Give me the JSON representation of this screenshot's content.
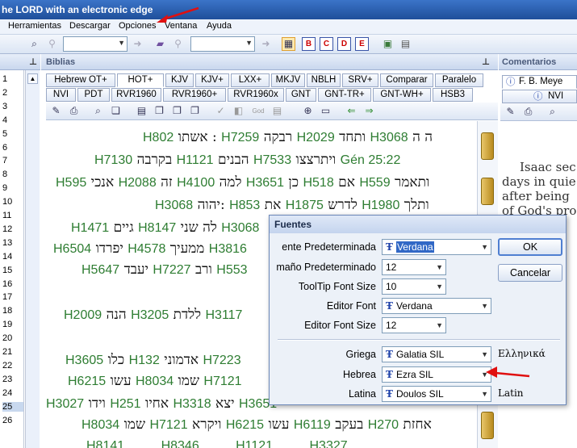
{
  "title": "he LORD with an electronic edge",
  "menu": [
    "Herramientas",
    "Descargar",
    "Opciones",
    "Ventana",
    "Ayuda"
  ],
  "panels": {
    "bibles": "Biblias",
    "comments": "Comentarios"
  },
  "line_numbers": [
    "1",
    "2",
    "3",
    "4",
    "5",
    "6",
    "7",
    "8",
    "9",
    "10",
    "11",
    "12",
    "13",
    "14",
    "15",
    "16",
    "17",
    "18",
    "19",
    "20",
    "21",
    "22",
    "23",
    "24",
    "25",
    "26"
  ],
  "selected_line": "25",
  "bible_tabs_row1": [
    "Hebrew OT+",
    "HOT+",
    "KJV",
    "KJV+",
    "LXX+",
    "MKJV",
    "NBLH",
    "SRV+",
    "Comparar",
    "Paralelo"
  ],
  "bible_tabs_row2": [
    "NVI",
    "PDT",
    "RVR1960",
    "RVR1960+",
    "RVR1960x",
    "GNT",
    "GNT-TR+",
    "GNT-WH+",
    "HSB3"
  ],
  "active_tab": "HOT+",
  "comment_tabs": [
    "F. B. Meye",
    "NVI"
  ],
  "verses": [
    {
      "t1": "ה ה",
      "s1": "H3068",
      "t2": "ותחד",
      "s2": "H2029",
      "t3": "רבקה",
      "s3": "H7259",
      "t4": "אשתו :",
      "s4": "H802"
    },
    {
      "t1": "Gén 25:22",
      "s1": "",
      "t2": "ויתרצצו",
      "s2": "H7533",
      "t3": "הבנים",
      "s3": "H1121",
      "t4": "בקרבה",
      "s4": "H7130"
    },
    {
      "t1": "ותאמר",
      "s1": "H559",
      "t2": "אם",
      "s2": "H518",
      "t3": "כן",
      "s3": "H3651",
      "t4": "למה",
      "s4": "H4100",
      "t5": "זה",
      "s5": "H2088",
      "t6": "אנכי",
      "s6": "H595"
    },
    {
      "t1": "ותלך",
      "s1": "H1980",
      "t2": "לדרש",
      "s2": "H1875",
      "t3": "את",
      "s3": "H853",
      "t4": "יהוה:",
      "s4": "H3068"
    },
    {
      "t1": "H3068",
      "t2": "לה שני",
      "t3": "H8147",
      "t4": "גיים",
      "t5": "H1471"
    },
    {
      "t1": "H3816",
      "t2": "ממעיך",
      "t3": "H4578",
      "t4": "יפרדו",
      "t5": "H6504"
    },
    {
      "t1": "H553",
      "t2": "ורב",
      "t3": "H7227",
      "t4": "יעבד",
      "t5": "H5647"
    },
    {
      "t1": "H3117",
      "t2": "ללדת",
      "t3": "H3205",
      "t4": "הנה",
      "t5": "H2009"
    },
    {
      "t1": "H7223",
      "t2": "אדמוני",
      "t3": "H132",
      "t4": "כלו",
      "t5": "H3605"
    },
    {
      "t1": "H7121",
      "t2": "שמו",
      "t3": "H8034",
      "t4": "עשו",
      "t5": "H6215"
    },
    {
      "t1": "H3651",
      "t2": "יצא",
      "t3": "H3318",
      "t4": "אחיו",
      "t5": "H251",
      "t6": "וידו",
      "t7": "H3027"
    },
    {
      "t1": "אחזת",
      "s1": "H270",
      "t2": "בעקב",
      "s2": "H6119",
      "t3": "עשו",
      "s3": "H6215",
      "t4": "ויקרא",
      "s4": "H7121",
      "t5": "שמו",
      "s5": "H8034"
    },
    {
      "t1": "H1121",
      "t2": "H3327",
      "t3": "H8346",
      "t4": "H8141"
    }
  ],
  "commentary": [
    "Isaac sec",
    "days in quie",
    "after being",
    "of God's pro"
  ],
  "dialog": {
    "title": "Fuentes",
    "fields": [
      {
        "label": "ente Predeterminada",
        "value": "Verdana",
        "has_icon": true
      },
      {
        "label": "maño Predeterminado",
        "value": "12",
        "has_icon": false
      },
      {
        "label": "ToolTip Font Size",
        "value": "10",
        "has_icon": false
      },
      {
        "label": "Editor Font",
        "value": "Verdana",
        "has_icon": true
      },
      {
        "label": "Editor Font Size",
        "value": "12",
        "has_icon": false
      },
      {
        "label": "Griega",
        "value": "Galatia SIL",
        "has_icon": true,
        "sample": "Ελληνικά"
      },
      {
        "label": "Hebrea",
        "value": "Ezra SIL",
        "has_icon": true,
        "sample": ""
      },
      {
        "label": "Latina",
        "value": "Doulos SIL",
        "has_icon": true,
        "sample": "Latin"
      }
    ],
    "ok": "OK",
    "cancel": "Cancelar"
  },
  "colors": {
    "strong": "#2e7d32",
    "arrow": "#e01010",
    "title_bar": "#2a5db0"
  }
}
